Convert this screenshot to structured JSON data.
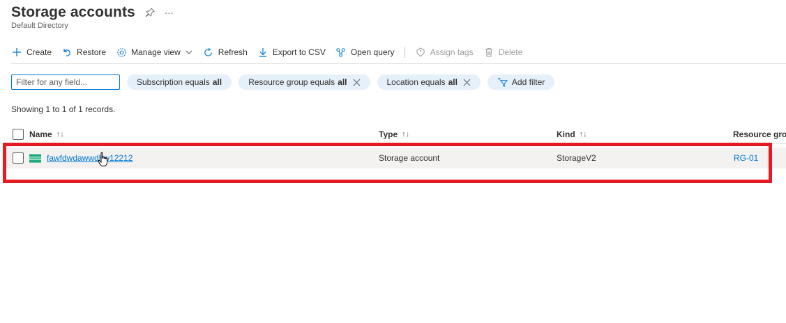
{
  "header": {
    "title": "Storage accounts",
    "subtitle": "Default Directory",
    "more_glyph": "···"
  },
  "toolbar": {
    "create": "Create",
    "restore": "Restore",
    "manage_view": "Manage view",
    "refresh": "Refresh",
    "export_csv": "Export to CSV",
    "open_query": "Open query",
    "assign_tags": "Assign tags",
    "delete": "Delete"
  },
  "filters": {
    "placeholder": "Filter for any field...",
    "subscription": {
      "label": "Subscription equals",
      "value": "all"
    },
    "resource_group": {
      "label": "Resource group equals",
      "value": "all"
    },
    "location": {
      "label": "Location equals",
      "value": "all"
    },
    "add_filter": "Add filter"
  },
  "records_text": "Showing 1 to 1 of 1 records.",
  "table": {
    "columns": {
      "name": "Name",
      "type": "Type",
      "kind": "Kind",
      "resource_group": "Resource grou"
    },
    "sort_glyph": "↑↓",
    "rows": [
      {
        "name": "fawfdwdawwdhw12212",
        "type": "Storage account",
        "kind": "StorageV2",
        "resource_group": "RG-01"
      }
    ]
  },
  "colors": {
    "accent": "#0078d4",
    "highlight": "#e41b22",
    "pill_bg": "#e6f0fb",
    "row_bg": "#f3f2f1",
    "storage_icon": "#1ca37a"
  },
  "icons": {
    "pin": "pin-icon",
    "more": "more-icon",
    "create": "plus-icon",
    "restore": "undo-icon",
    "manage_view": "gear-icon",
    "refresh": "refresh-icon",
    "export_csv": "download-icon",
    "open_query": "query-icon",
    "assign_tags": "tag-icon",
    "delete": "trash-icon",
    "add_filter": "add-filter-icon",
    "close": "close-icon",
    "storage": "storage-account-icon",
    "cursor": "hand-cursor-icon"
  }
}
